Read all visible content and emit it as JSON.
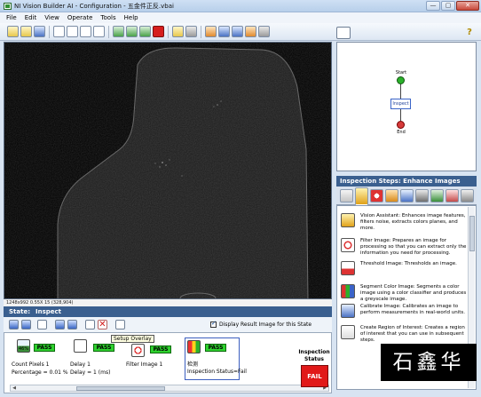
{
  "window": {
    "title": "NI Vision Builder AI - Configuration - 五金件正反.vbai",
    "controls": [
      "—",
      "▢",
      "✕"
    ]
  },
  "menu": [
    "File",
    "Edit",
    "View",
    "Operate",
    "Tools",
    "Help"
  ],
  "image_status": "1248x992 0.55X 15    (328,904)",
  "state": {
    "label": "State:",
    "value": "Inspect"
  },
  "display_result_label": "Display Result Image for this State",
  "overlay_tip": "Setup Overlay",
  "steps": [
    {
      "name": "Count Pixels 1",
      "detail": "Percentage = 0.01 %",
      "result": "PASS",
      "icon_value": "46%"
    },
    {
      "name": "Delay 1",
      "detail": "Delay = 1 (ms)",
      "result": "PASS"
    },
    {
      "name": "Filter Image 1",
      "detail": "",
      "result": "PASS"
    },
    {
      "name": "检测",
      "detail": "Inspection Status=Fail",
      "result": "PASS"
    }
  ],
  "inspection_status": {
    "title": "Inspection Status",
    "value": "FAIL",
    "color": "#e11919"
  },
  "flow": {
    "start": "Start",
    "inspect": "Inspect",
    "end": "End"
  },
  "steps_panel": {
    "title": "Inspection Steps: Enhance Images",
    "items": [
      {
        "text": "Vision Assistant: Enhances image features, filters noise, extracts colors planes, and more."
      },
      {
        "text": "Filter Image: Prepares an image for processing so that you can extract only the information you need for processing."
      },
      {
        "text": "Threshold Image: Thresholds an image."
      },
      {
        "text": "Segment Color Image: Segments a color image using a color classifier and produces a greyscale image."
      },
      {
        "text": "Calibrate Image: Calibrates an image to perform measurements in real-world units."
      },
      {
        "text": "Create Region of Interest: Creates a region of interest that you can use in subsequent steps."
      }
    ]
  },
  "watermark": "石鑫华",
  "help_glyph": "?"
}
